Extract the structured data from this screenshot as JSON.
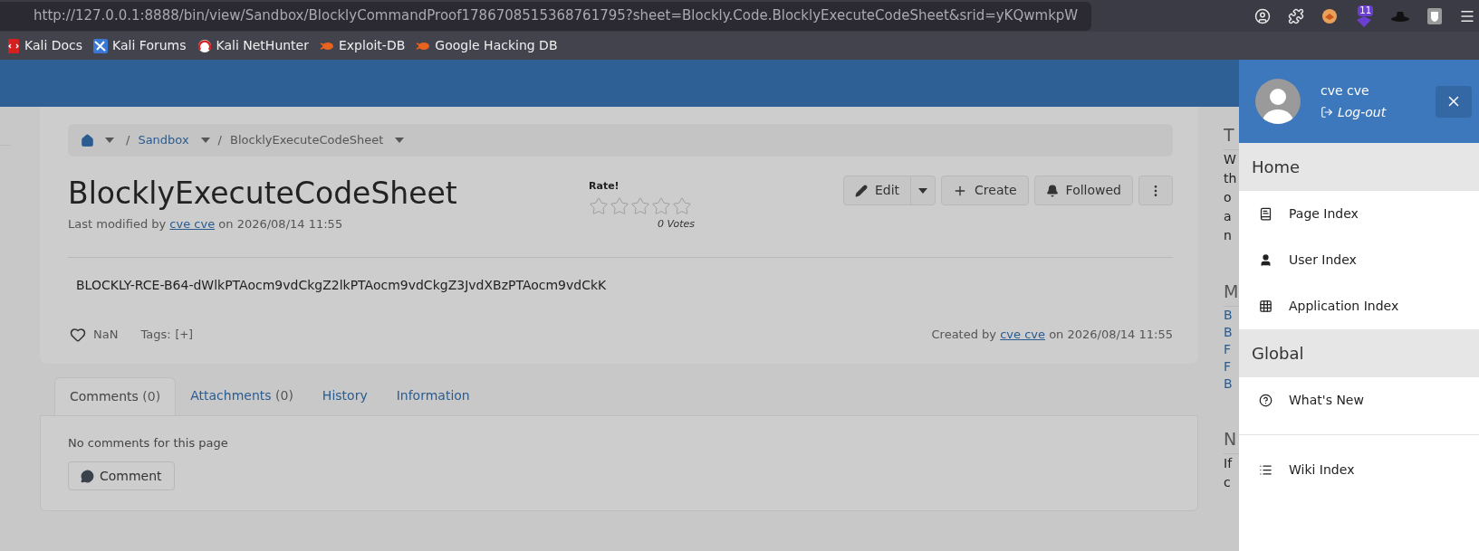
{
  "browser": {
    "url": "http://127.0.0.1:8888/bin/view/Sandbox/BlocklyCommandProof1786708515368761795?sheet=Blockly.Code.BlocklyExecuteCodeSheet&srid=yKQwmkpW",
    "extension_badge": "11",
    "bookmarks": [
      {
        "kind": "docs",
        "label": "Kali Docs"
      },
      {
        "kind": "forums",
        "label": "Kali Forums"
      },
      {
        "kind": "nethunter",
        "label": "Kali NetHunter"
      },
      {
        "kind": "exploit",
        "label": "Exploit-DB"
      },
      {
        "kind": "exploit",
        "label": "Google Hacking DB"
      }
    ]
  },
  "breadcrumb": [
    {
      "kind": "home"
    },
    {
      "kind": "link",
      "separator": "/",
      "label": "Sandbox"
    },
    {
      "kind": "current",
      "separator": "/",
      "label": "BlocklyExecuteCodeSheet"
    }
  ],
  "page": {
    "title": "BlocklyExecuteCodeSheet",
    "modified": {
      "before": "Last modified by",
      "author": "cve cve",
      "after": "on 2026/08/14 11:55"
    },
    "rating": {
      "label": "Rate!",
      "stars": 0,
      "votes": "0 Votes"
    },
    "actions": [
      {
        "kind": "edit",
        "label": "Edit"
      },
      {
        "kind": "create",
        "label": "Create"
      },
      {
        "kind": "followed",
        "label": "Followed"
      },
      {
        "kind": "more"
      }
    ],
    "content": "BLOCKLY-RCE-B64-dWlkPTAocm9vdCkgZ2lkPTAocm9vdCkgZ3JvdXBzPTAocm9vdCkK",
    "likes": "NaN",
    "tags_label": "Tags:",
    "tags_add": "[+]",
    "created": {
      "before": "Created by",
      "author": "cve cve",
      "after": "on 2026/08/14 11:55"
    }
  },
  "tabs": [
    {
      "label": "Comments",
      "count": "(0)",
      "selected": true
    },
    {
      "label": "Attachments",
      "count": "(0)",
      "selected": false
    },
    {
      "label": "History",
      "selected": false
    },
    {
      "label": "Information",
      "selected": false
    }
  ],
  "comments": {
    "empty": "No comments for this page",
    "button": "Comment"
  },
  "right_column": [
    {
      "kind": "heading",
      "text": "T"
    },
    {
      "kind": "line",
      "text": "W"
    },
    {
      "kind": "line",
      "text": "th"
    },
    {
      "kind": "line",
      "text": "o"
    },
    {
      "kind": "line",
      "text": "a"
    },
    {
      "kind": "line",
      "text": "n"
    },
    {
      "kind": "heading",
      "text": "M"
    },
    {
      "kind": "link",
      "text": "B"
    },
    {
      "kind": "link",
      "text": "B"
    },
    {
      "kind": "link",
      "text": "F"
    },
    {
      "kind": "link",
      "text": "F"
    },
    {
      "kind": "link",
      "text": "B"
    },
    {
      "kind": "heading",
      "text": "N"
    },
    {
      "kind": "line",
      "text": "If"
    },
    {
      "kind": "line",
      "text": "c"
    }
  ],
  "drawer": {
    "user": "cve cve",
    "logout": "Log-out",
    "sections": [
      {
        "title": "Home",
        "items": [
          {
            "kind": "book",
            "label": "Page Index"
          },
          {
            "kind": "user",
            "label": "User Index"
          },
          {
            "kind": "grid",
            "label": "Application Index"
          }
        ]
      },
      {
        "title": "Global",
        "items": [
          {
            "kind": "question",
            "label": "What's New"
          }
        ]
      }
    ],
    "extra_items": [
      {
        "kind": "list",
        "label": "Wiki Index"
      }
    ]
  }
}
